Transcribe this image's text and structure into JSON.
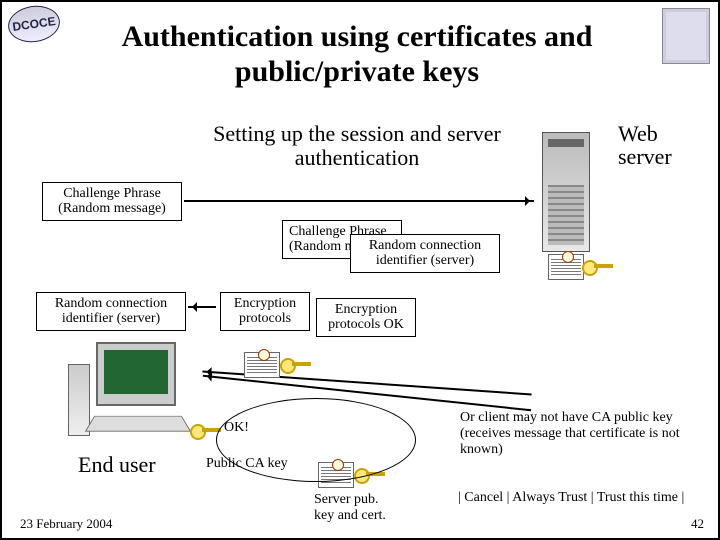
{
  "logo_left": "DCOCE",
  "title": "Authentication using certificates and public/private keys",
  "subtitle": "Setting up the session and server authentication",
  "web_server": "Web\nserver",
  "boxes": {
    "challenge_client": "Challenge Phrase\n(Random message)",
    "challenge_mid": "Challenge Phrase\n(Random m",
    "rand_conn_mid": "Random connection\nidentifier (server)",
    "rand_conn_left": "Random connection\nidentifier (server)",
    "enc_protocols": "Encryption\nprotocols",
    "enc_ok": "Encryption\nprotocols OK"
  },
  "ok": "OK!",
  "public_ca": "Public CA key",
  "server_pub": "Server pub.\nkey and cert.",
  "end_user": "End user",
  "note_right": "Or client may not have CA public key (receives message that certificate is not known)",
  "trust_links": "| Cancel | Always Trust | Trust this time |",
  "footer_date": "23 February 2004",
  "page_num": "42"
}
